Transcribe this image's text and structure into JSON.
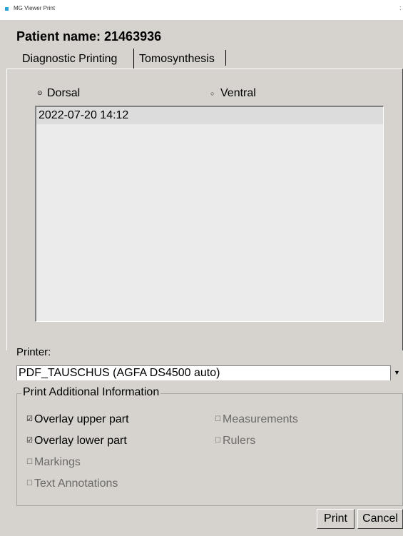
{
  "window": {
    "title": "MG Viewer Print",
    "close_glyph": ":"
  },
  "patient_label": "Patient name: 21463936",
  "tabs": [
    {
      "label": "Diagnostic Printing",
      "active": true
    },
    {
      "label": "Tomosynthesis",
      "active": false
    }
  ],
  "view_options": {
    "dorsal": {
      "label": "Dorsal",
      "selected": true,
      "glyph": "⊙"
    },
    "ventral": {
      "label": "Ventral",
      "selected": false,
      "glyph": "○"
    }
  },
  "studies": [
    "2022-07-20 14:12"
  ],
  "printer": {
    "label": "Printer:",
    "selected": "PDF_TAUSCHUS (AGFA DS4500 auto)",
    "dropdown_glyph": "▼"
  },
  "additional_info": {
    "title": "Print Additional Information",
    "checked_glyph": "☑",
    "unchecked_glyph": "☐",
    "options": [
      {
        "label": "Overlay upper part",
        "checked": true,
        "enabled": true
      },
      {
        "label": "Measurements",
        "checked": false,
        "enabled": false
      },
      {
        "label": "Overlay lower part",
        "checked": true,
        "enabled": true
      },
      {
        "label": "Rulers",
        "checked": false,
        "enabled": false
      },
      {
        "label": "Markings",
        "checked": false,
        "enabled": false
      },
      {
        "label": "Text Annotations",
        "checked": false,
        "enabled": false
      }
    ]
  },
  "buttons": {
    "print": "Print",
    "cancel": "Cancel"
  },
  "colors": {
    "dialog_bg": "#d6d3ce",
    "list_bg": "#ebebeb",
    "selection_bg": "#dcdcdc",
    "app_icon": "#2ba3d8"
  }
}
